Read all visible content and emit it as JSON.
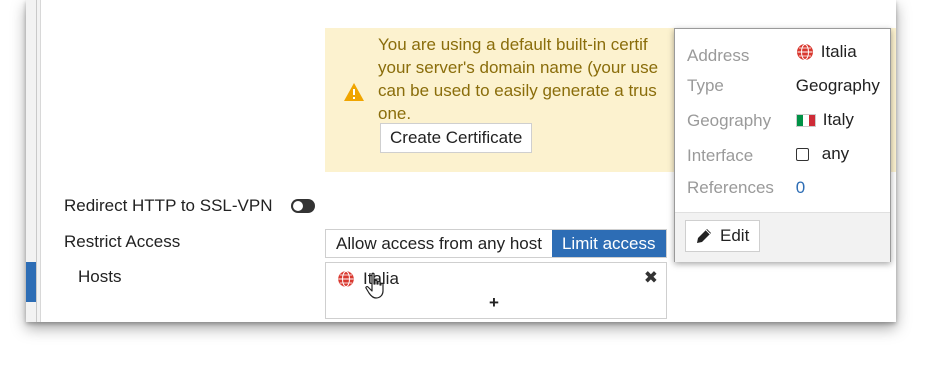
{
  "warning_banner": {
    "lines": [
      "You are using a default built-in certif",
      "your server's domain name (your use",
      "can be used to easily generate a trus",
      "one."
    ],
    "create_certificate_label": "Create Certificate",
    "icon": "warning-triangle-icon",
    "text_color": "#8a6d0b",
    "background_color": "#fcf2cf"
  },
  "form": {
    "redirect_label": "Redirect HTTP to SSL-VPN",
    "redirect_enabled": false,
    "restrict_label": "Restrict Access",
    "restrict_options": [
      "Allow access from any host",
      "Limit access"
    ],
    "restrict_selected": "Limit access",
    "hosts_label": "Hosts",
    "hosts_entries": [
      {
        "label": "Italia",
        "icon": "globe-icon"
      }
    ],
    "remove_symbol": "✖",
    "add_symbol": "+"
  },
  "popup": {
    "rows": {
      "address": {
        "key": "Address",
        "value": "Italia",
        "icon": "globe-icon"
      },
      "type": {
        "key": "Type",
        "value": "Geography"
      },
      "geography": {
        "key": "Geography",
        "value": "Italy",
        "icon": "italy-flag-icon"
      },
      "interface": {
        "key": "Interface",
        "value": "any",
        "icon": "checkbox-icon"
      },
      "references": {
        "key": "References",
        "value": "0"
      }
    },
    "edit_label": "Edit"
  },
  "colors": {
    "accent": "#2d6db5",
    "label_gray": "#9a9a9a"
  }
}
